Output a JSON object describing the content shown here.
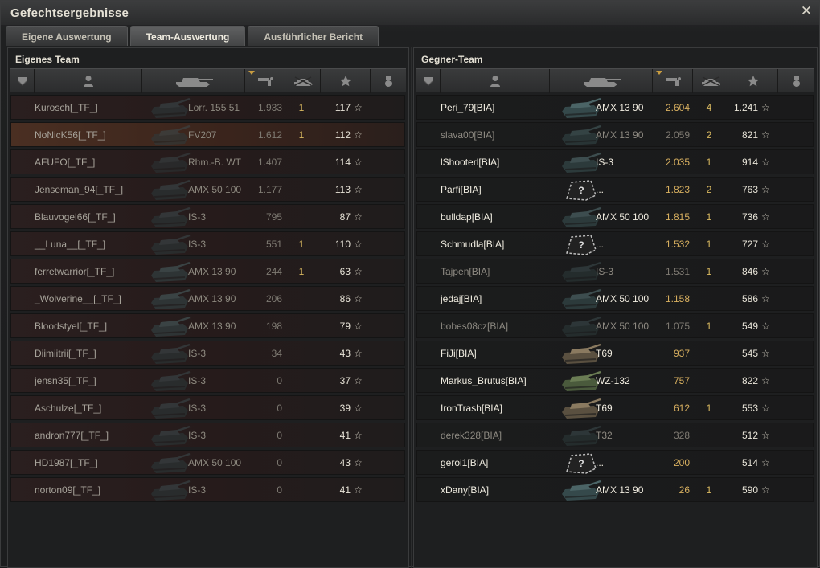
{
  "window": {
    "title": "Gefechtsergebnisse",
    "close_glyph": "✕"
  },
  "tabs": [
    {
      "label": "Eigene Auswertung",
      "active": false
    },
    {
      "label": "Team-Auswertung",
      "active": true
    },
    {
      "label": "Ausführlicher Bericht",
      "active": false
    }
  ],
  "header_icons": [
    "platoon-icon",
    "player-icon",
    "tank-icon",
    "damage-icon",
    "frags-icon",
    "xp-star-icon",
    "medal-icon"
  ],
  "colors": {
    "accent": "#c89c40",
    "damage_enemy": "#d8b060",
    "frags": "#d8b860"
  },
  "own_team": {
    "title": "Eigenes Team",
    "rows": [
      {
        "name": "Kurosch[_TF_]",
        "vehicle": "Lorr. 155 51",
        "damage": "1.933",
        "kills": "1",
        "xp": "117",
        "tank": "spg",
        "state": "normal"
      },
      {
        "name": "NoNicK56[_TF_]",
        "vehicle": "FV207",
        "damage": "1.612",
        "kills": "1",
        "xp": "112",
        "tank": "spg",
        "state": "highlight"
      },
      {
        "name": "AFUFO[_TF_]",
        "vehicle": "Rhm.-B. WT",
        "damage": "1.407",
        "kills": "",
        "xp": "114",
        "tank": "td",
        "state": "normal"
      },
      {
        "name": "Jenseman_94[_TF_]",
        "vehicle": "AMX 50 100",
        "damage": "1.177",
        "kills": "",
        "xp": "113",
        "tank": "heavy",
        "state": "normal"
      },
      {
        "name": "Blauvogel66[_TF_]",
        "vehicle": "IS-3",
        "damage": "795",
        "kills": "",
        "xp": "87",
        "tank": "heavy",
        "state": "normal"
      },
      {
        "name": "__Luna__[_TF_]",
        "vehicle": "IS-3",
        "damage": "551",
        "kills": "1",
        "xp": "110",
        "tank": "heavy",
        "state": "normal"
      },
      {
        "name": "ferretwarrior[_TF_]",
        "vehicle": "AMX 13 90",
        "damage": "244",
        "kills": "1",
        "xp": "63",
        "tank": "light",
        "state": "normal"
      },
      {
        "name": "_Wolverine__[_TF_]",
        "vehicle": "AMX 13 90",
        "damage": "206",
        "kills": "",
        "xp": "86",
        "tank": "light",
        "state": "normal"
      },
      {
        "name": "Bloodstyel[_TF_]",
        "vehicle": "AMX 13 90",
        "damage": "198",
        "kills": "",
        "xp": "79",
        "tank": "light",
        "state": "normal"
      },
      {
        "name": "Diimiitrii[_TF_]",
        "vehicle": "IS-3",
        "damage": "34",
        "kills": "",
        "xp": "43",
        "tank": "heavy",
        "state": "normal"
      },
      {
        "name": "jensn35[_TF_]",
        "vehicle": "IS-3",
        "damage": "0",
        "kills": "",
        "xp": "37",
        "tank": "heavy",
        "state": "normal"
      },
      {
        "name": "Aschulze[_TF_]",
        "vehicle": "IS-3",
        "damage": "0",
        "kills": "",
        "xp": "39",
        "tank": "heavy",
        "state": "normal"
      },
      {
        "name": "andron777[_TF_]",
        "vehicle": "IS-3",
        "damage": "0",
        "kills": "",
        "xp": "41",
        "tank": "heavy",
        "state": "normal"
      },
      {
        "name": "HD1987[_TF_]",
        "vehicle": "AMX 50 100",
        "damage": "0",
        "kills": "",
        "xp": "43",
        "tank": "heavy",
        "state": "normal"
      },
      {
        "name": "norton09[_TF_]",
        "vehicle": "IS-3",
        "damage": "0",
        "kills": "",
        "xp": "41",
        "tank": "heavy",
        "state": "normal"
      }
    ]
  },
  "enemy_team": {
    "title": "Gegner-Team",
    "rows": [
      {
        "name": "Peri_79[BIA]",
        "vehicle": "AMX 13 90",
        "damage": "2.604",
        "kills": "4",
        "xp": "1.241",
        "tank": "light",
        "state": "alive"
      },
      {
        "name": "slava00[BIA]",
        "vehicle": "AMX 13 90",
        "damage": "2.059",
        "kills": "2",
        "xp": "821",
        "tank": "light",
        "state": "dead"
      },
      {
        "name": "lShooterl[BIA]",
        "vehicle": "IS-3",
        "damage": "2.035",
        "kills": "1",
        "xp": "914",
        "tank": "heavy",
        "state": "alive"
      },
      {
        "name": "Parfi[BIA]",
        "vehicle": "...",
        "damage": "1.823",
        "kills": "2",
        "xp": "763",
        "tank": "unknown",
        "state": "alive"
      },
      {
        "name": "bulldap[BIA]",
        "vehicle": "AMX 50 100",
        "damage": "1.815",
        "kills": "1",
        "xp": "736",
        "tank": "heavy",
        "state": "alive"
      },
      {
        "name": "Schmudla[BIA]",
        "vehicle": "...",
        "damage": "1.532",
        "kills": "1",
        "xp": "727",
        "tank": "unknown",
        "state": "alive"
      },
      {
        "name": "Tajpen[BIA]",
        "vehicle": "IS-3",
        "damage": "1.531",
        "kills": "1",
        "xp": "846",
        "tank": "heavy",
        "state": "dead"
      },
      {
        "name": "jedaj[BIA]",
        "vehicle": "AMX 50 100",
        "damage": "1.158",
        "kills": "",
        "xp": "586",
        "tank": "heavy",
        "state": "alive"
      },
      {
        "name": "bobes08cz[BIA]",
        "vehicle": "AMX 50 100",
        "damage": "1.075",
        "kills": "1",
        "xp": "549",
        "tank": "heavy",
        "state": "dead"
      },
      {
        "name": "FiJi[BIA]",
        "vehicle": "T69",
        "damage": "937",
        "kills": "",
        "xp": "545",
        "tank": "camo",
        "state": "alive"
      },
      {
        "name": "Markus_Brutus[BIA]",
        "vehicle": "WZ-132",
        "damage": "757",
        "kills": "",
        "xp": "822",
        "tank": "green",
        "state": "alive"
      },
      {
        "name": "IronTrash[BIA]",
        "vehicle": "T69",
        "damage": "612",
        "kills": "1",
        "xp": "553",
        "tank": "camo",
        "state": "alive"
      },
      {
        "name": "derek328[BIA]",
        "vehicle": "T32",
        "damage": "328",
        "kills": "",
        "xp": "512",
        "tank": "heavy",
        "state": "dead"
      },
      {
        "name": "geroi1[BIA]",
        "vehicle": "...",
        "damage": "200",
        "kills": "",
        "xp": "514",
        "tank": "unknown",
        "state": "alive"
      },
      {
        "name": "xDany[BIA]",
        "vehicle": "AMX 13 90",
        "damage": "26",
        "kills": "1",
        "xp": "590",
        "tank": "light",
        "state": "alive"
      }
    ]
  }
}
